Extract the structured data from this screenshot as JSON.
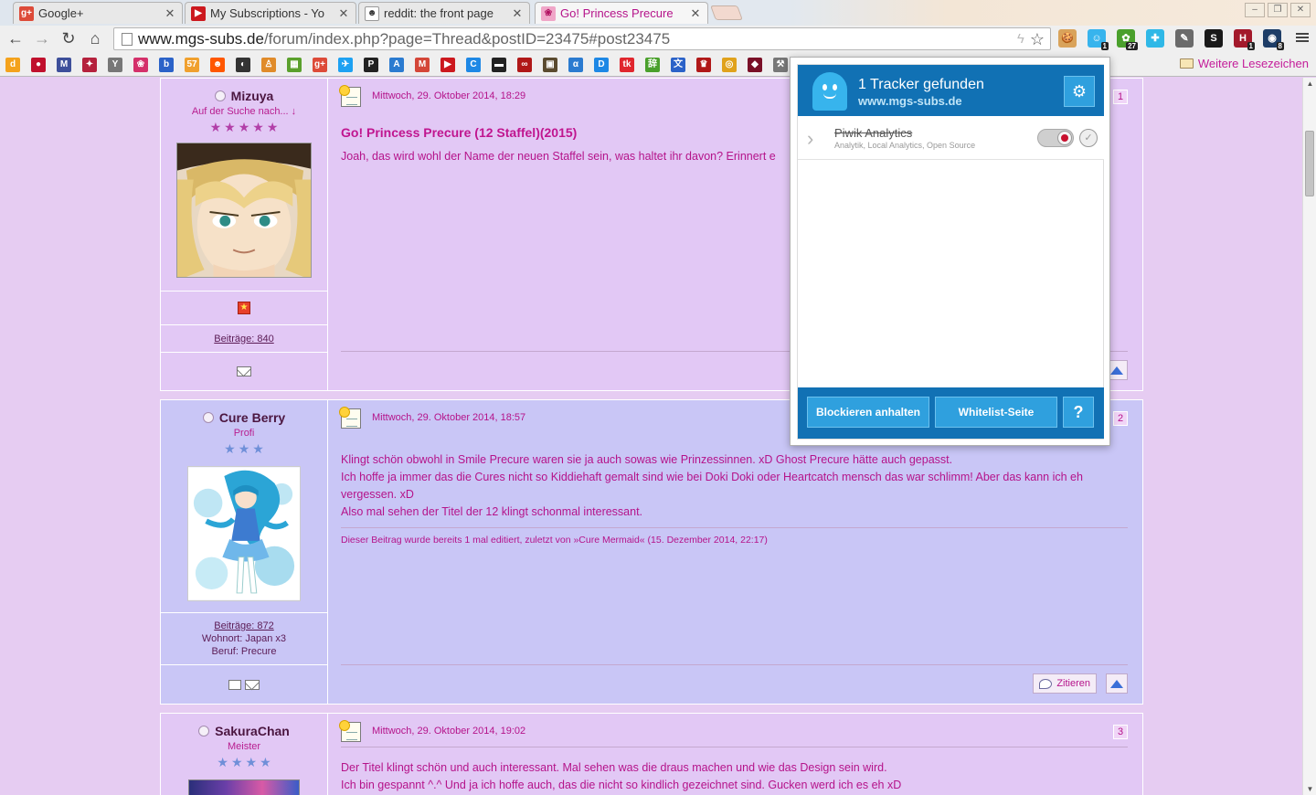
{
  "browser": {
    "tabs": [
      {
        "title": "Google+",
        "favicon": "google-plus-icon",
        "color": "#dd4b39",
        "glyph": "g+"
      },
      {
        "title": "My Subscriptions - Yo",
        "favicon": "youtube-icon",
        "color": "#cc181e",
        "glyph": "▶"
      },
      {
        "title": "reddit: the front page",
        "favicon": "reddit-icon",
        "color": "#ffffff",
        "glyph": "👽"
      },
      {
        "title": "Go! Princess Precure",
        "favicon": "mgs-subs-icon",
        "color": "#f0a6c8",
        "glyph": "❀",
        "active": true
      }
    ],
    "url_domain": "www.mgs-subs.de",
    "url_path": "/forum/index.php?page=Thread&postID=23475#post23475",
    "extensions": [
      {
        "name": "cookie-icon",
        "color": "#d9a35b",
        "glyph": "🍪",
        "badge": ""
      },
      {
        "name": "ghostery-icon",
        "color": "#37b4ed",
        "glyph": "☺",
        "badge": "1"
      },
      {
        "name": "feedly-icon",
        "color": "#4aa02c",
        "glyph": "✿",
        "badge": "27"
      },
      {
        "name": "share-icon",
        "color": "#2fb8e7",
        "glyph": "✚",
        "badge": ""
      },
      {
        "name": "eyedropper-icon",
        "color": "#6b6b6b",
        "glyph": "✎",
        "badge": ""
      },
      {
        "name": "s-extension-icon",
        "color": "#1a1a1a",
        "glyph": "S",
        "badge": ""
      },
      {
        "name": "h-extension-icon",
        "color": "#a3192b",
        "glyph": "H",
        "badge": "1"
      },
      {
        "name": "monitor-extension-icon",
        "color": "#1d3d67",
        "glyph": "◉",
        "badge": "8"
      }
    ],
    "bookmarks": [
      {
        "name": "bookmark-d",
        "color": "#f4a21c",
        "glyph": "d"
      },
      {
        "name": "bookmark-red-circle",
        "color": "#c0102d",
        "glyph": "●"
      },
      {
        "name": "bookmark-mail",
        "color": "#3d4f9a",
        "glyph": "M"
      },
      {
        "name": "bookmark-anime",
        "color": "#b5213d",
        "glyph": "✦"
      },
      {
        "name": "bookmark-y",
        "color": "#777777",
        "glyph": "Y"
      },
      {
        "name": "bookmark-flower",
        "color": "#d4306a",
        "glyph": "❀"
      },
      {
        "name": "bookmark-b",
        "color": "#2b62c8",
        "glyph": "b"
      },
      {
        "name": "bookmark-57",
        "color": "#f0a02e",
        "glyph": "57"
      },
      {
        "name": "bookmark-reddit",
        "color": "#ff5700",
        "glyph": "☻"
      },
      {
        "name": "bookmark-github",
        "color": "#333333",
        "glyph": "◐"
      },
      {
        "name": "bookmark-person",
        "color": "#e08b2a",
        "glyph": "♙"
      },
      {
        "name": "bookmark-squares",
        "color": "#5aa02c",
        "glyph": "▦"
      },
      {
        "name": "bookmark-google-plus",
        "color": "#dd4b39",
        "glyph": "g+"
      },
      {
        "name": "bookmark-twitter",
        "color": "#1da1f2",
        "glyph": "✈"
      },
      {
        "name": "bookmark-circle-p",
        "color": "#222222",
        "glyph": "P"
      },
      {
        "name": "bookmark-a",
        "color": "#2b7bd0",
        "glyph": "A"
      },
      {
        "name": "bookmark-gmail",
        "color": "#d44638",
        "glyph": "M"
      },
      {
        "name": "bookmark-youtube",
        "color": "#cc181e",
        "glyph": "▶"
      },
      {
        "name": "bookmark-c",
        "color": "#1e88e5",
        "glyph": "C"
      },
      {
        "name": "bookmark-dark",
        "color": "#222222",
        "glyph": "▬"
      },
      {
        "name": "bookmark-ribbon",
        "color": "#b01818",
        "glyph": "∞"
      },
      {
        "name": "bookmark-box",
        "color": "#5a4a2f",
        "glyph": "▣"
      },
      {
        "name": "bookmark-hat",
        "color": "#2b7bd0",
        "glyph": "α"
      },
      {
        "name": "bookmark-d-blue",
        "color": "#1e88e5",
        "glyph": "D"
      },
      {
        "name": "bookmark-tk",
        "color": "#e0262e",
        "glyph": "tk"
      },
      {
        "name": "bookmark-kanji",
        "color": "#4aa02c",
        "glyph": "辞"
      },
      {
        "name": "bookmark-translate",
        "color": "#2b62c8",
        "glyph": "文"
      },
      {
        "name": "bookmark-card",
        "color": "#b01818",
        "glyph": "♛"
      },
      {
        "name": "bookmark-coin",
        "color": "#e0a21c",
        "glyph": "◎"
      },
      {
        "name": "bookmark-shield",
        "color": "#7a1027",
        "glyph": "◆"
      },
      {
        "name": "bookmark-tool",
        "color": "#777777",
        "glyph": "⚒"
      }
    ],
    "other_bookmarks": "Weitere Lesezeichen"
  },
  "ghostery": {
    "title": "1 Tracker gefunden",
    "site": "www.mgs-subs.de",
    "tracker_name": "Piwik Analytics",
    "tracker_categories": "Analytik, Local Analytics, Open Source",
    "pause_label": "Blockieren anhalten",
    "whitelist_label": "Whitelist-Seite",
    "help_label": "?"
  },
  "posts": [
    {
      "author": "Mizuya",
      "rank": "Auf der Suche nach... ↓",
      "stars": 5,
      "star_color": "#b23fa8",
      "avatar": "blonde-anime-avatar",
      "posts_count": "Beiträge: 840",
      "date": "Mittwoch, 29. Oktober 2014, 18:29",
      "number": "1",
      "title": "Go! Princess Precure (12 Staffel)(2015)",
      "body": [
        "Joah, das wird wohl der Name der neuen Staffel sein, was haltet ihr davon? Erinnert e"
      ]
    },
    {
      "author": "Cure Berry",
      "rank": "Profi",
      "stars": 3,
      "star_color": "#6f8fd8",
      "avatar": "cure-mermaid-avatar",
      "posts_count": "Beiträge: 872",
      "location": "Wohnort: Japan x3",
      "job": "Beruf: Precure",
      "date": "Mittwoch, 29. Oktober 2014, 18:57",
      "number": "2",
      "body": [
        "Klingt schön obwohl in Smile Precure waren sie ja auch sowas wie Prinzessinnen. xD Ghost Precure hätte auch gepasst.",
        "Ich hoffe ja immer das die Cures nicht so Kiddiehaft gemalt sind wie bei Doki Doki oder Heartcatch mensch das war schlimm! Aber das kann ich eh vergessen. xD",
        "Also mal sehen der Titel der 12 klingt schonmal interessant."
      ],
      "edit_note": "Dieser Beitrag wurde bereits 1 mal editiert, zuletzt von »Cure Mermaid« (15. Dezember 2014, 22:17)",
      "quote_label": "Zitieren"
    },
    {
      "author": "SakuraChan",
      "rank": "Meister",
      "stars": 4,
      "star_color": "#6f8fd8",
      "date": "Mittwoch, 29. Oktober 2014, 19:02",
      "number": "3",
      "body": [
        "Der Titel klingt schön und auch interessant. Mal sehen was die draus machen und wie das Design sein wird.",
        "Ich bin gespannt ^.^ Und ja ich hoffe auch, das die nicht so kindlich gezeichnet sind. Gucken werd ich es eh xD"
      ]
    }
  ]
}
